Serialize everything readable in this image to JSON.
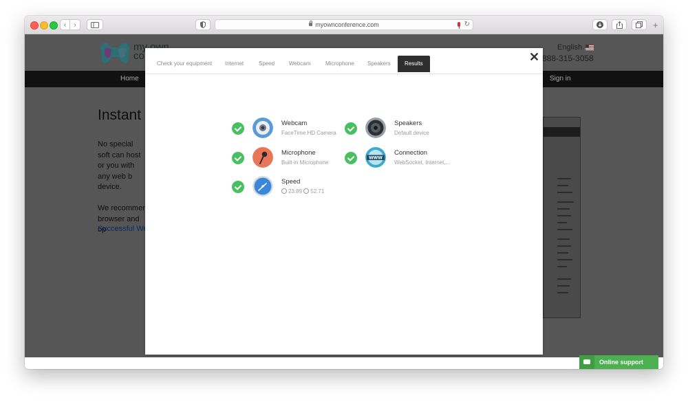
{
  "browser": {
    "url": "myownconference.com",
    "back_label": "‹",
    "forward_label": "›",
    "reload_label": "↻",
    "new_tab_label": "+"
  },
  "site": {
    "logo_text": "my own\nco",
    "language": "English",
    "phone": "888-315-3058",
    "nav": {
      "home": "Home",
      "signin": "Sign in"
    },
    "hero": {
      "title": "Instant",
      "text": "No special soft can host or you with any web b device.\n\nWe recommen browser and op",
      "link": "Successful Web"
    }
  },
  "modal": {
    "tabs": [
      "Check your equipment",
      "Internet",
      "Speed",
      "Webcam",
      "Microphone",
      "Speakers",
      "Results"
    ],
    "active_tab": "Results",
    "close_label": "✕",
    "results": [
      {
        "name": "Webcam",
        "detail": "FaceTime HD Camera",
        "icon": "webcam-icon",
        "icon_color": "#5b9bd5",
        "status": "ok"
      },
      {
        "name": "Speakers",
        "detail": "Default device",
        "icon": "speaker-icon",
        "icon_color": "#9aa0a8",
        "status": "ok"
      },
      {
        "name": "Microphone",
        "detail": "Built-in Microphone",
        "icon": "microphone-icon",
        "icon_color": "#e8775a",
        "status": "ok"
      },
      {
        "name": "Connection",
        "detail": "WebSocket, Internet,...",
        "icon": "www-globe-icon",
        "icon_color": "#3fa9c9",
        "status": "ok"
      },
      {
        "name": "Speed",
        "download": "23.89",
        "upload": "52.71",
        "icon": "speedometer-icon",
        "icon_color": "#3a86d8",
        "status": "ok"
      }
    ]
  },
  "support": {
    "label": "Online support"
  },
  "colors": {
    "success": "#48c05f",
    "support": "#4caf50",
    "active_tab": "#2e2e2e"
  }
}
